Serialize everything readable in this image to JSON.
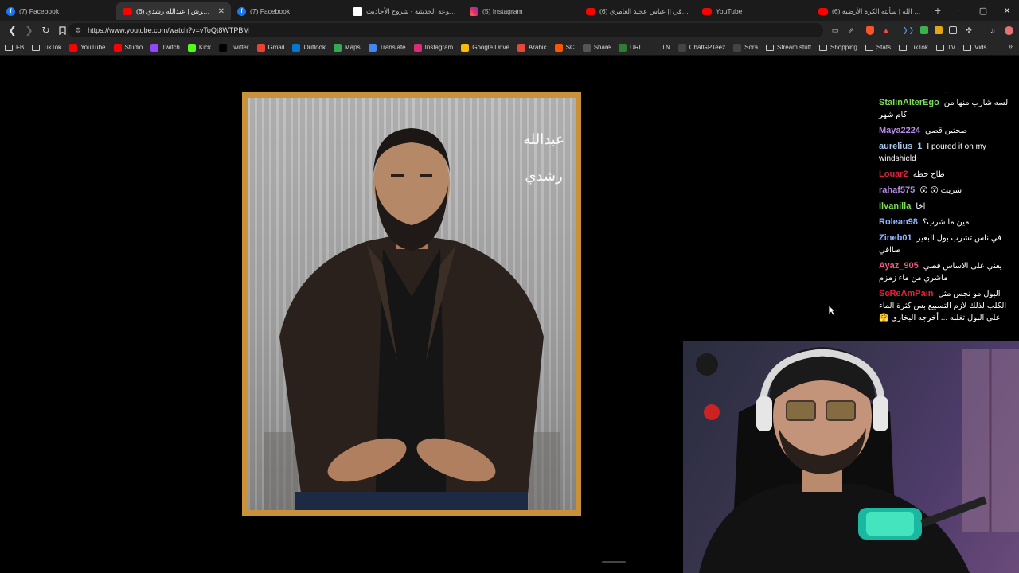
{
  "tabs": [
    {
      "title": "(7) Facebook",
      "icon": "facebook-icon",
      "favclass": "fav-fb",
      "active": false
    },
    {
      "title": "(6) تبرير التحرش | عبدالله رشدي",
      "icon": "youtube-icon",
      "favclass": "fav-yt",
      "active": true
    },
    {
      "title": "(7) Facebook",
      "icon": "facebook-icon",
      "favclass": "fav-fb",
      "active": false
    },
    {
      "title": "الموسوعة الحديثية - شروح الأحاديث",
      "icon": "page-icon",
      "favclass": "fav-white",
      "active": false
    },
    {
      "title": "(5) Instagram",
      "icon": "instagram-icon",
      "favclass": "fav-ig",
      "active": false
    },
    {
      "title": "(6) اجمل ساقي || عباس عجيد العامري",
      "icon": "youtube-icon",
      "favclass": "fav-yt",
      "active": false
    },
    {
      "title": "YouTube",
      "icon": "youtube-icon",
      "favclass": "fav-yt",
      "active": false
    },
    {
      "title": "(6) سفره إلى الله | سألته الكرة الأرضية",
      "icon": "youtube-icon",
      "favclass": "fav-yt",
      "active": false
    }
  ],
  "address_bar": {
    "url": "https://www.youtube.com/watch?v=vToQt8WTPBM"
  },
  "bookmarks": [
    {
      "label": "FB",
      "icon": "folder-icon",
      "color": ""
    },
    {
      "label": "TikTok",
      "icon": "folder-icon",
      "color": ""
    },
    {
      "label": "YouTube",
      "icon": "youtube-icon",
      "color": "#ff0000"
    },
    {
      "label": "Studio",
      "icon": "youtube-studio-icon",
      "color": "#ff0000"
    },
    {
      "label": "Twitch",
      "icon": "twitch-icon",
      "color": "#9146ff"
    },
    {
      "label": "Kick",
      "icon": "kick-icon",
      "color": "#53fc18"
    },
    {
      "label": "Twitter",
      "icon": "x-icon",
      "color": "#000000"
    },
    {
      "label": "Gmail",
      "icon": "gmail-icon",
      "color": "#ea4335"
    },
    {
      "label": "Outlook",
      "icon": "outlook-icon",
      "color": "#0078d4"
    },
    {
      "label": "Maps",
      "icon": "maps-icon",
      "color": "#34a853"
    },
    {
      "label": "Translate",
      "icon": "translate-icon",
      "color": "#4285f4"
    },
    {
      "label": "Instagram",
      "icon": "instagram-icon",
      "color": "#dd2a7b"
    },
    {
      "label": "Google Drive",
      "icon": "drive-icon",
      "color": "#fbbc04"
    },
    {
      "label": "Arabic",
      "icon": "arabic-icon",
      "color": "#e8453c"
    },
    {
      "label": "SC",
      "icon": "sc-icon",
      "color": "#ff5500"
    },
    {
      "label": "Share",
      "icon": "share-icon",
      "color": "#555555"
    },
    {
      "label": "URL",
      "icon": "url-icon",
      "color": "#2e7d32"
    },
    {
      "label": "TN",
      "icon": "tn-icon",
      "color": ""
    },
    {
      "label": "ChatGPTeez",
      "icon": "chatgpt-icon",
      "color": "#444444"
    },
    {
      "label": "Sora",
      "icon": "sora-icon",
      "color": "#444444"
    },
    {
      "label": "Stream stuff",
      "icon": "folder-icon",
      "color": ""
    },
    {
      "label": "Shopping",
      "icon": "folder-icon",
      "color": ""
    },
    {
      "label": "Stats",
      "icon": "folder-icon",
      "color": ""
    },
    {
      "label": "TikTok",
      "icon": "folder-icon",
      "color": ""
    },
    {
      "label": "TV",
      "icon": "folder-icon",
      "color": ""
    },
    {
      "label": "Vids",
      "icon": "folder-icon",
      "color": ""
    }
  ],
  "chat": {
    "top_mark": "—",
    "messages": [
      {
        "user": "StalinAlterEgo",
        "color": "#7ddc5a",
        "text": "لسه شارب منها من كام شهر"
      },
      {
        "user": "Maya2224",
        "color": "#b78be8",
        "text": "صحتين قصي"
      },
      {
        "user": "aurelius_1",
        "color": "#a9c6e8",
        "text": "I poured it on my windshield"
      },
      {
        "user": "Louar2",
        "color": "#e0233b",
        "text": "طاح حظه"
      },
      {
        "user": "rahaf575",
        "color": "#b78be8",
        "text": "شربت 😮 😮"
      },
      {
        "user": "Ilvanilla",
        "color": "#7ddc5a",
        "text": "اخا"
      },
      {
        "user": "Rolean98",
        "color": "#8fb4ff",
        "text": "مين ما شرب؟"
      },
      {
        "user": "Zineb01",
        "color": "#8fb4ff",
        "text": "في ناس تشرب بول البعير صاافي"
      },
      {
        "user": "Ayaz_905",
        "color": "#e85b7a",
        "text": "يعني على الاساس قصي ماشري من ماء زمزم"
      },
      {
        "user": "ScReAmPain",
        "color": "#e0233b",
        "text": "البول مو نجس مثل الكلب لذلك لازم التسبيع بس كثرة الماء على البول تغلبه ... أخرجه البخاري 🤗"
      }
    ]
  },
  "video": {
    "watermark": "عبدالله رشدي"
  }
}
